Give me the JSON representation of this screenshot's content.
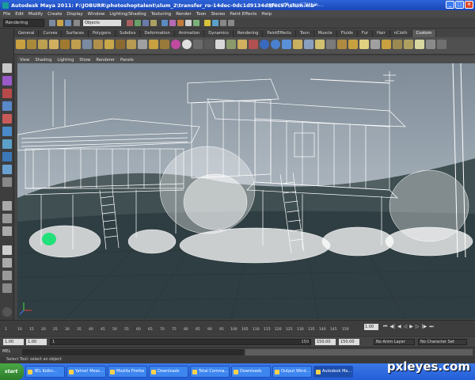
{
  "window": {
    "title": "Autodesk Maya 2011: F:\\JOBURR\\photoshoptalent\\slum_2\\transfer_ro-14dec-0dc1d9134d8f6c57\\slum.mb*",
    "second_window_title": "grassClump67Main..."
  },
  "menu": [
    "File",
    "Edit",
    "Modify",
    "Create",
    "Display",
    "Window",
    "Lighting/Shading",
    "Texturing",
    "Render",
    "Toon",
    "Stereo",
    "Paint Effects",
    "Help"
  ],
  "status_line": {
    "mode": "Rendering",
    "object_field": "Objects"
  },
  "shelf_tabs": [
    "General",
    "Curves",
    "Surfaces",
    "Polygons",
    "Subdivs",
    "Deformation",
    "Animation",
    "Dynamics",
    "Rendering",
    "PaintEffects",
    "Toon",
    "Muscle",
    "Fluids",
    "Fur",
    "Hair",
    "nCloth",
    "Custom"
  ],
  "shelf_active": "Custom",
  "panel_menu": [
    "View",
    "Shading",
    "Lighting",
    "Show",
    "Renderer",
    "Panels"
  ],
  "time_slider": {
    "ticks": [
      "1",
      "10",
      "15",
      "20",
      "25",
      "30",
      "35",
      "40",
      "45",
      "50",
      "55",
      "60",
      "65",
      "70",
      "75",
      "80",
      "85",
      "90",
      "95",
      "100",
      "105",
      "110",
      "115",
      "120",
      "125",
      "130",
      "135",
      "140",
      "145",
      "150"
    ],
    "current_frame": "1.00"
  },
  "range_slider": {
    "start_time": "1.00",
    "range_start": "1.00",
    "range_bar_label": "1",
    "range_end_label": "150",
    "range_end": "150.00",
    "end_time": "150.00",
    "anim_layer": "No Anim Layer",
    "character_set": "No Character Set"
  },
  "command_line": {
    "label": "MEL"
  },
  "help_line": "Select Tool: select an object",
  "taskbar": {
    "start": "start",
    "items": [
      "3EL Kolkn...",
      "Yahoo! Mess...",
      "Mozilla Firefox",
      "Downloads",
      "Total Comma...",
      "Downloads",
      "Output Wind...",
      "Autodesk Ma..."
    ],
    "active_item": "Autodesk Ma..."
  },
  "watermark": "pxleyes.com",
  "colors": {
    "viewport_sky": "#8e9aa6",
    "viewport_ground": "#3a4a4c",
    "wireframe": "#ffffff",
    "selection_green": "#22e07a",
    "taskbar_blue": "#245ed8"
  }
}
